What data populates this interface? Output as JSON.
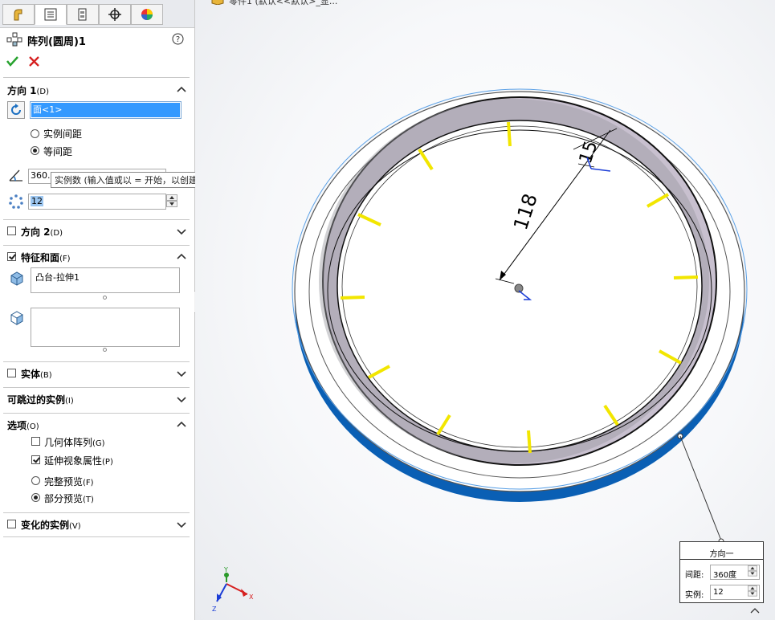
{
  "breadcrumb": {
    "text": "零件1 (默认<<默认>_显..."
  },
  "feature": {
    "title": "阵列(圆周)1",
    "help_icon": "help-icon"
  },
  "direction1": {
    "title": "方向 1",
    "shortcut": "(D)",
    "face_value": "面<1>",
    "radio_instance_spacing": "实例间距",
    "radio_equal_spacing": "等间距",
    "angle_value": "360.0",
    "count_value": "12",
    "tooltip": "实例数 (输入值或以 = 开始，以创建方程式)"
  },
  "direction2": {
    "title": "方向 2",
    "shortcut": "(D)"
  },
  "features_faces": {
    "title": "特征和面",
    "shortcut": "(F)",
    "item": "凸台-拉伸1"
  },
  "bodies": {
    "title": "实体",
    "shortcut": "(B)"
  },
  "skip": {
    "title": "可跳过的实例",
    "shortcut": "(I)"
  },
  "options": {
    "title": "选项",
    "shortcut": "(O)",
    "geometry_pattern": "几何体阵列",
    "geometry_pattern_key": "(G)",
    "propagate_visual": "延伸视象属性",
    "propagate_visual_key": "(P)",
    "full_preview": "完整预览",
    "full_preview_key": "(F)",
    "partial_preview": "部分预览",
    "partial_preview_key": "(T)"
  },
  "vary": {
    "title": "变化的实例",
    "shortcut": "(V)"
  },
  "viewport": {
    "dim_118": "118",
    "dim_15": "15",
    "callout_title": "方向一",
    "callout_spacing_label": "间距:",
    "callout_spacing_value": "360度",
    "callout_count_label": "实例:",
    "callout_count_value": "12",
    "axis_x": "X",
    "axis_y": "Y",
    "axis_z": "Z"
  },
  "colors": {
    "accent_blue": "#0a5fb4",
    "tick_yellow": "#f2e600",
    "selection_blue": "#3399ff"
  }
}
